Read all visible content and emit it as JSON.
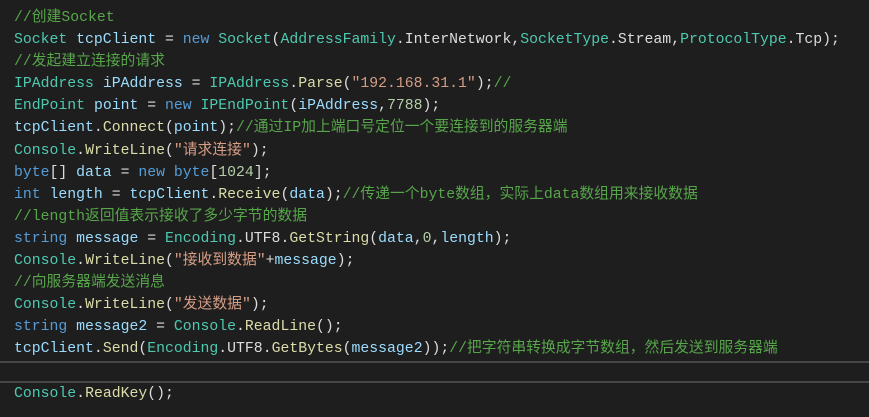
{
  "colors": {
    "background": "#1e1e1e",
    "comment": "#57a64a",
    "type": "#4ec9b0",
    "keyword": "#569cd6",
    "variable": "#9cdcfe",
    "method": "#dcdcaa",
    "string": "#d69d85",
    "plain": "#dcdcdc",
    "current_line_border": "#464646"
  },
  "lines": [
    {
      "tokens": [
        [
          "comment",
          "//创建Socket"
        ]
      ]
    },
    {
      "tokens": [
        [
          "type",
          "Socket"
        ],
        [
          "plain",
          " "
        ],
        [
          "var",
          "tcpClient"
        ],
        [
          "plain",
          " = "
        ],
        [
          "kw",
          "new"
        ],
        [
          "plain",
          " "
        ],
        [
          "type",
          "Socket"
        ],
        [
          "plain",
          "("
        ],
        [
          "type",
          "AddressFamily"
        ],
        [
          "plain",
          "."
        ],
        [
          "plain",
          "InterNetwork"
        ],
        [
          "plain",
          ","
        ],
        [
          "type",
          "SocketType"
        ],
        [
          "plain",
          "."
        ],
        [
          "plain",
          "Stream"
        ],
        [
          "plain",
          ","
        ],
        [
          "type",
          "ProtocolType"
        ],
        [
          "plain",
          "."
        ],
        [
          "plain",
          "Tcp"
        ],
        [
          "plain",
          ");"
        ]
      ]
    },
    {
      "tokens": [
        [
          "comment",
          "//发起建立连接的请求"
        ]
      ]
    },
    {
      "tokens": [
        [
          "type",
          "IPAddress"
        ],
        [
          "plain",
          " "
        ],
        [
          "var",
          "iPAddress"
        ],
        [
          "plain",
          " = "
        ],
        [
          "type",
          "IPAddress"
        ],
        [
          "plain",
          "."
        ],
        [
          "method",
          "Parse"
        ],
        [
          "plain",
          "("
        ],
        [
          "str",
          "\"192.168.31.1\""
        ],
        [
          "plain",
          ");"
        ],
        [
          "comment",
          "//"
        ]
      ]
    },
    {
      "tokens": [
        [
          "type",
          "EndPoint"
        ],
        [
          "plain",
          " "
        ],
        [
          "var",
          "point"
        ],
        [
          "plain",
          " = "
        ],
        [
          "kw",
          "new"
        ],
        [
          "plain",
          " "
        ],
        [
          "type",
          "IPEndPoint"
        ],
        [
          "plain",
          "("
        ],
        [
          "var",
          "iPAddress"
        ],
        [
          "plain",
          ","
        ],
        [
          "num",
          "7788"
        ],
        [
          "plain",
          ");"
        ]
      ]
    },
    {
      "tokens": [
        [
          "var",
          "tcpClient"
        ],
        [
          "plain",
          "."
        ],
        [
          "method",
          "Connect"
        ],
        [
          "plain",
          "("
        ],
        [
          "var",
          "point"
        ],
        [
          "plain",
          ");"
        ],
        [
          "comment",
          "//通过IP加上端口号定位一个要连接到的服务器端"
        ]
      ]
    },
    {
      "tokens": [
        [
          "type",
          "Console"
        ],
        [
          "plain",
          "."
        ],
        [
          "method",
          "WriteLine"
        ],
        [
          "plain",
          "("
        ],
        [
          "str",
          "\"请求连接\""
        ],
        [
          "plain",
          ");"
        ]
      ]
    },
    {
      "tokens": [
        [
          "kw",
          "byte"
        ],
        [
          "plain",
          "[] "
        ],
        [
          "var",
          "data"
        ],
        [
          "plain",
          " = "
        ],
        [
          "kw",
          "new"
        ],
        [
          "plain",
          " "
        ],
        [
          "kw",
          "byte"
        ],
        [
          "plain",
          "["
        ],
        [
          "num",
          "1024"
        ],
        [
          "plain",
          "];"
        ]
      ]
    },
    {
      "tokens": [
        [
          "kw",
          "int"
        ],
        [
          "plain",
          " "
        ],
        [
          "var",
          "length"
        ],
        [
          "plain",
          " = "
        ],
        [
          "var",
          "tcpClient"
        ],
        [
          "plain",
          "."
        ],
        [
          "method",
          "Receive"
        ],
        [
          "plain",
          "("
        ],
        [
          "var",
          "data"
        ],
        [
          "plain",
          ");"
        ],
        [
          "comment",
          "//传递一个byte数组，实际上data数组用来接收数据"
        ]
      ]
    },
    {
      "tokens": [
        [
          "comment",
          "//length返回值表示接收了多少字节的数据"
        ]
      ]
    },
    {
      "tokens": [
        [
          "kw",
          "string"
        ],
        [
          "plain",
          " "
        ],
        [
          "var",
          "message"
        ],
        [
          "plain",
          " = "
        ],
        [
          "type",
          "Encoding"
        ],
        [
          "plain",
          "."
        ],
        [
          "plain",
          "UTF8"
        ],
        [
          "plain",
          "."
        ],
        [
          "method",
          "GetString"
        ],
        [
          "plain",
          "("
        ],
        [
          "var",
          "data"
        ],
        [
          "plain",
          ","
        ],
        [
          "num",
          "0"
        ],
        [
          "plain",
          ","
        ],
        [
          "var",
          "length"
        ],
        [
          "plain",
          ");"
        ]
      ]
    },
    {
      "tokens": [
        [
          "type",
          "Console"
        ],
        [
          "plain",
          "."
        ],
        [
          "method",
          "WriteLine"
        ],
        [
          "plain",
          "("
        ],
        [
          "str",
          "\"接收到数据\""
        ],
        [
          "plain",
          "+"
        ],
        [
          "var",
          "message"
        ],
        [
          "plain",
          ");"
        ]
      ]
    },
    {
      "tokens": [
        [
          "comment",
          "//向服务器端发送消息"
        ]
      ]
    },
    {
      "tokens": [
        [
          "type",
          "Console"
        ],
        [
          "plain",
          "."
        ],
        [
          "method",
          "WriteLine"
        ],
        [
          "plain",
          "("
        ],
        [
          "str",
          "\"发送数据\""
        ],
        [
          "plain",
          ");"
        ]
      ]
    },
    {
      "tokens": [
        [
          "kw",
          "string"
        ],
        [
          "plain",
          " "
        ],
        [
          "var",
          "message2"
        ],
        [
          "plain",
          " = "
        ],
        [
          "type",
          "Console"
        ],
        [
          "plain",
          "."
        ],
        [
          "method",
          "ReadLine"
        ],
        [
          "plain",
          "();"
        ]
      ]
    },
    {
      "tokens": [
        [
          "var",
          "tcpClient"
        ],
        [
          "plain",
          "."
        ],
        [
          "method",
          "Send"
        ],
        [
          "plain",
          "("
        ],
        [
          "type",
          "Encoding"
        ],
        [
          "plain",
          "."
        ],
        [
          "plain",
          "UTF8"
        ],
        [
          "plain",
          "."
        ],
        [
          "method",
          "GetBytes"
        ],
        [
          "plain",
          "("
        ],
        [
          "var",
          "message2"
        ],
        [
          "plain",
          "));"
        ],
        [
          "comment",
          "//把字符串转换成字节数组，然后发送到服务器端"
        ]
      ]
    },
    {
      "current": true,
      "tokens": []
    },
    {
      "tokens": [
        [
          "type",
          "Console"
        ],
        [
          "plain",
          "."
        ],
        [
          "method",
          "ReadKey"
        ],
        [
          "plain",
          "();"
        ]
      ]
    }
  ]
}
